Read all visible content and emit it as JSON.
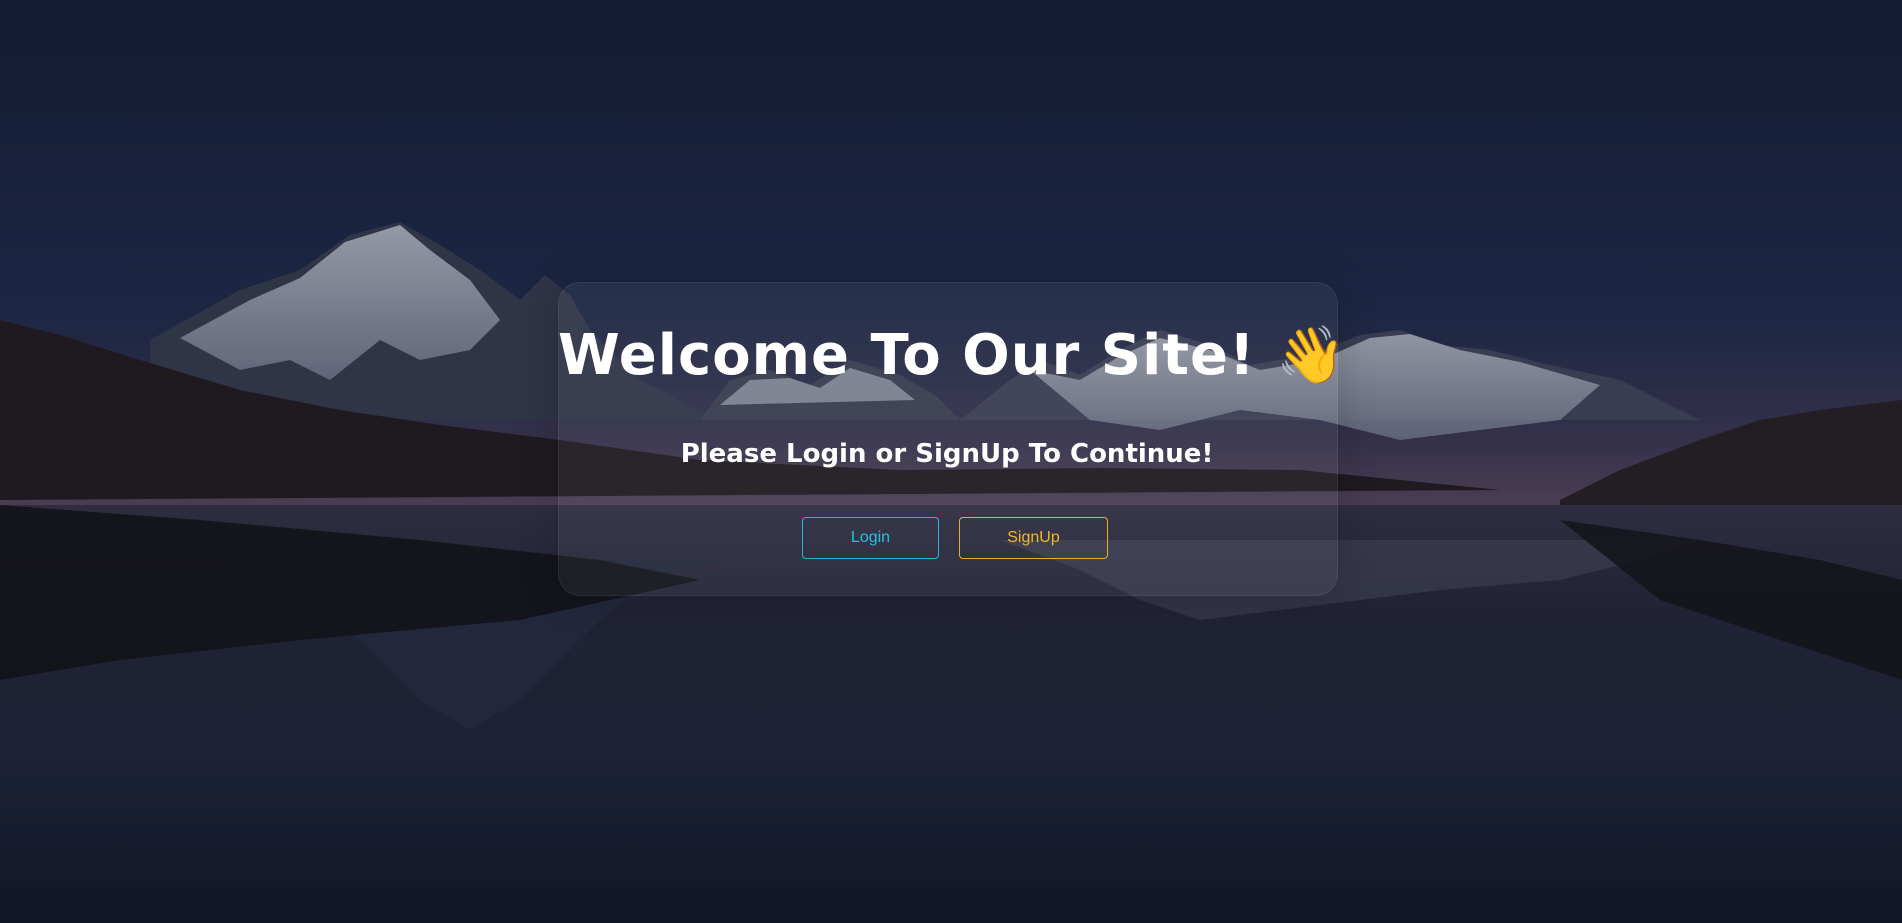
{
  "hero": {
    "title": "Welcome To Our Site!",
    "wave_emoji": "👋",
    "subtitle": "Please Login or SignUp To Continue!"
  },
  "actions": {
    "login_label": "Login",
    "signup_label": "SignUp"
  },
  "colors": {
    "login_accent": "#24c2e2",
    "signup_accent": "#f2b92a",
    "text": "#ffffff"
  }
}
